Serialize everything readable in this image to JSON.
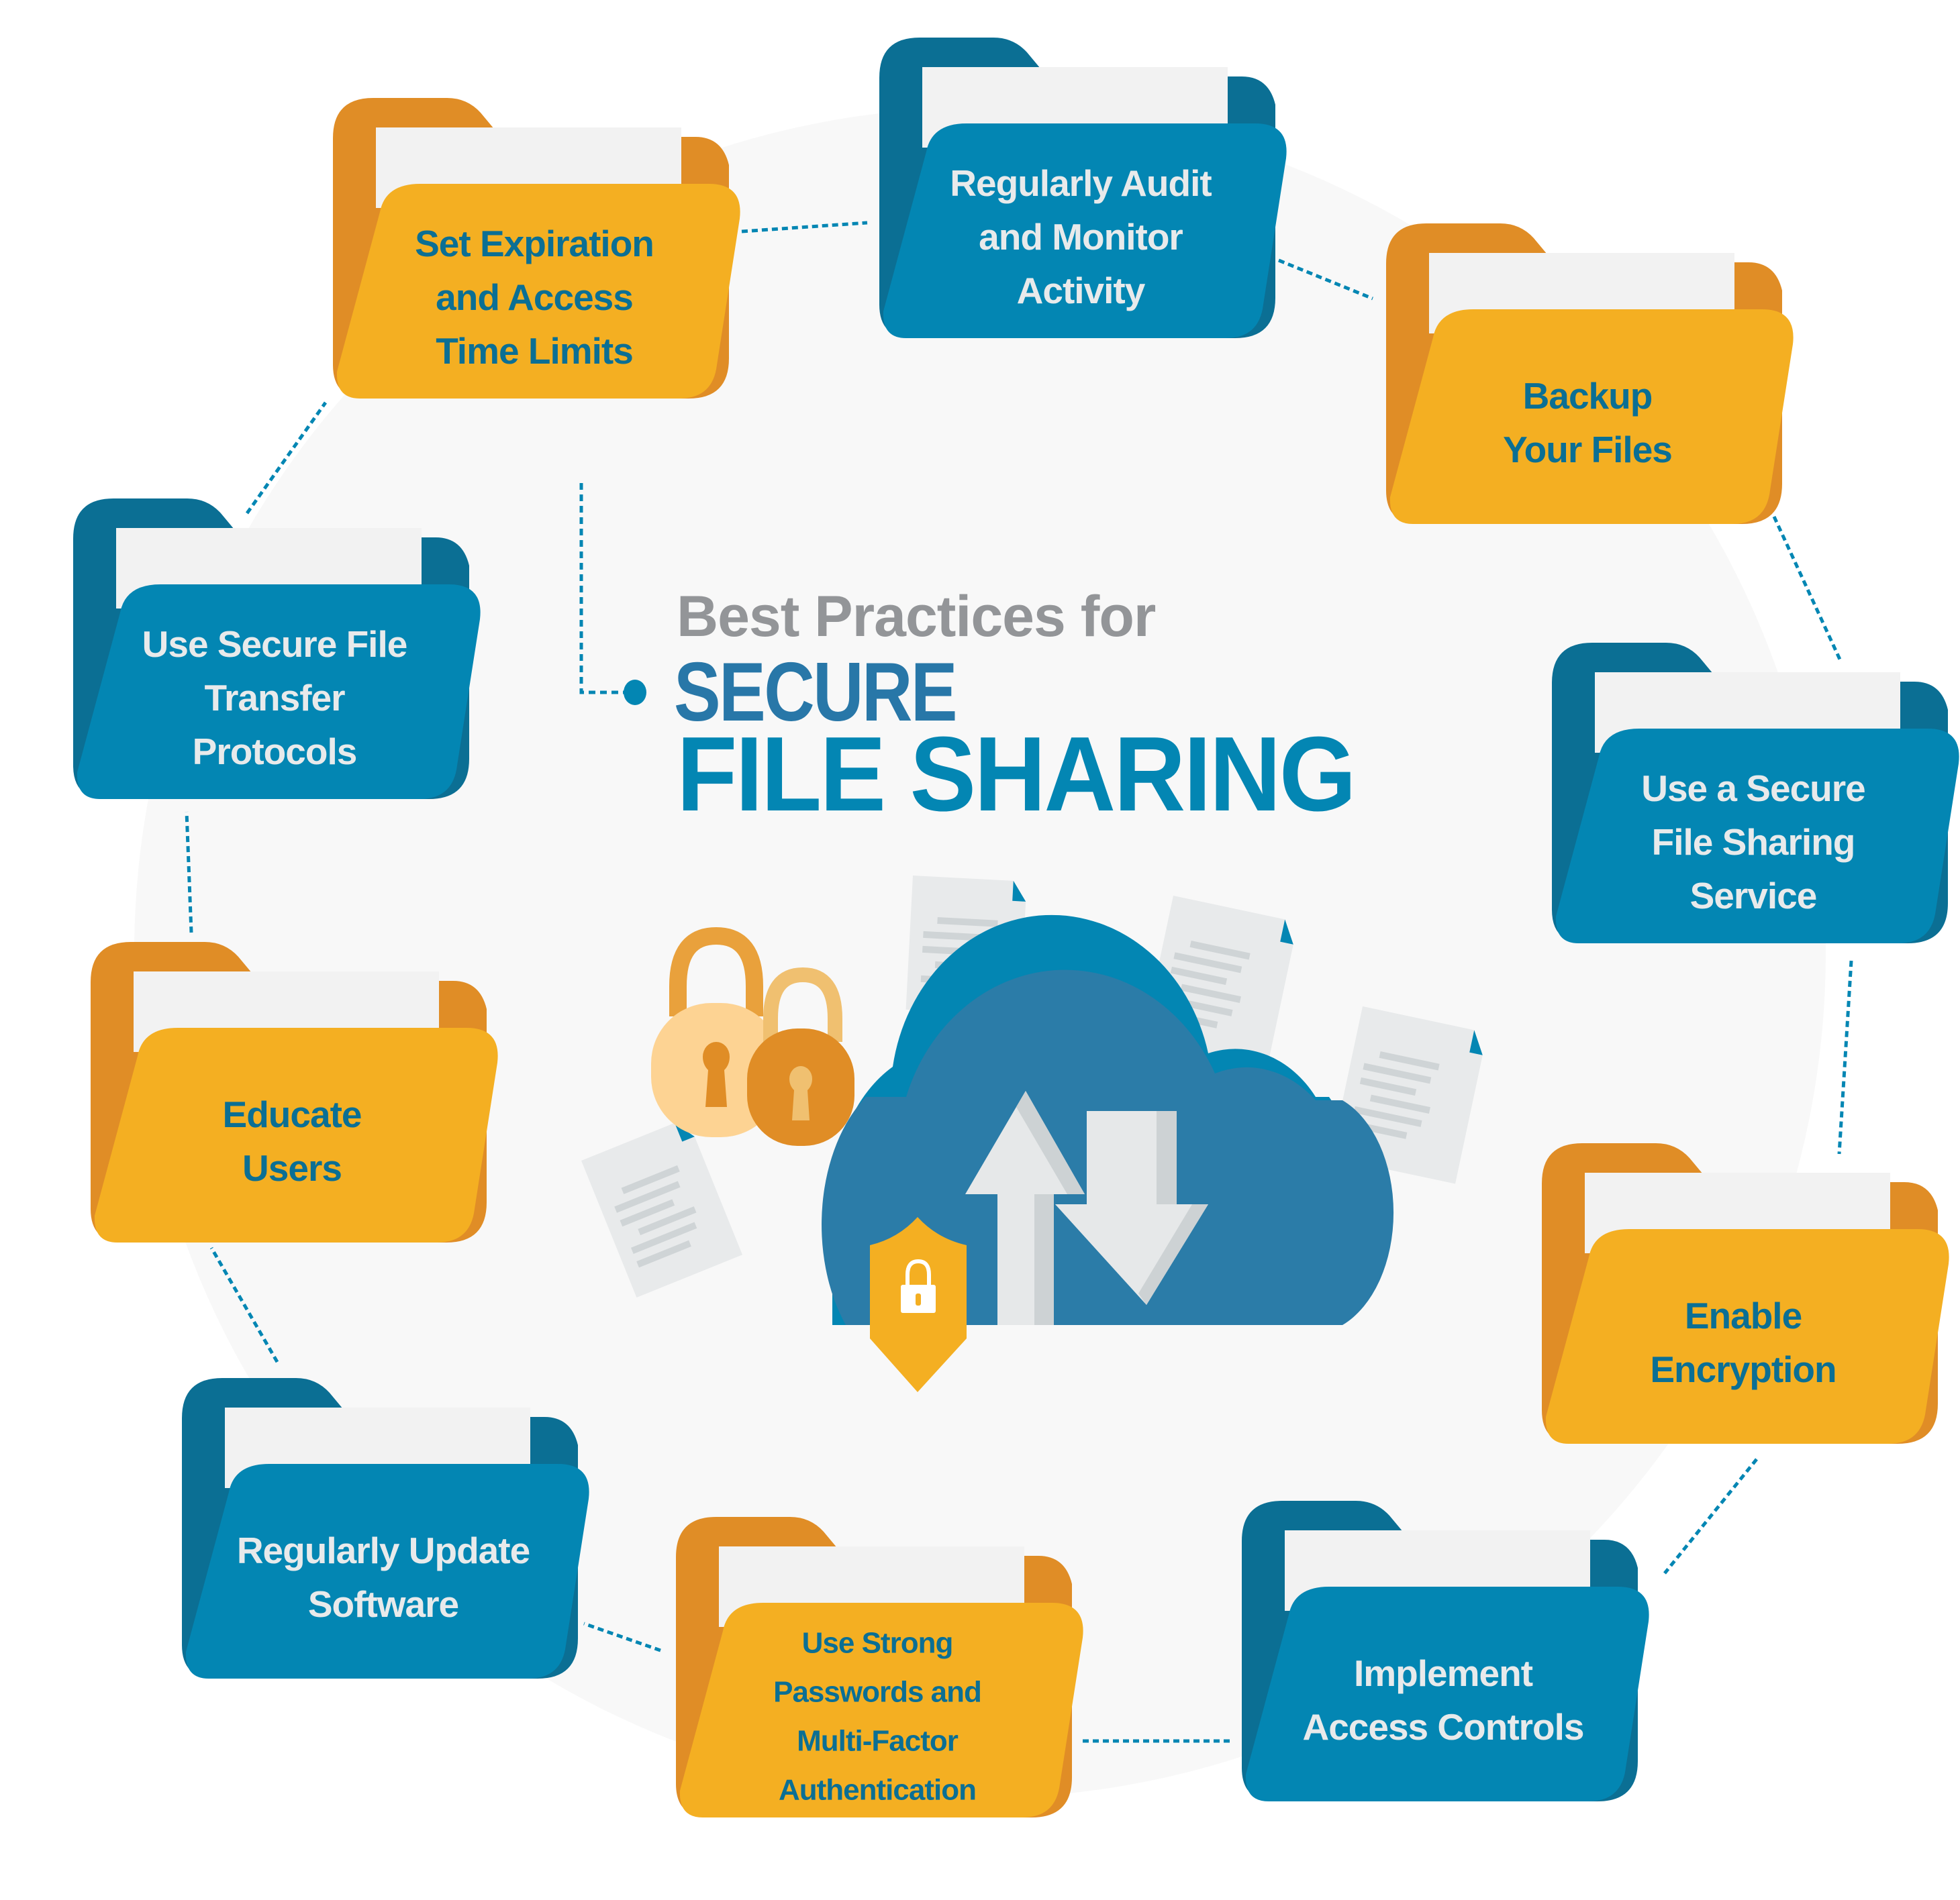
{
  "title": {
    "kicker": "Best Practices for",
    "line1": "SECURE",
    "line2": "FILE SHARING"
  },
  "colors": {
    "blue_front": "#0386b3",
    "blue_back": "#0b6f94",
    "yellow_front": "#f4af22",
    "yellow_back": "#e08d26",
    "paper": "#f2f2f2",
    "text_on_yellow": "#0b6f94",
    "text_on_blue": "#e8eaeb",
    "kicker_gray": "#939598",
    "secure_blue": "#2877a8",
    "file_sharing_blue": "#0386b3",
    "connector": "#0386b3",
    "background_circle": "#f8f8f8",
    "cloud": "#2b7ca8",
    "cloud_shadow": "#0386b3",
    "arrow": "#e6e8e9",
    "arrow_shade": "#cdd2d4",
    "shield": "#f4af22",
    "doc": "#e8eaeb",
    "doc_line": "#cfd4d6",
    "doc_corner": "#0386b3",
    "lock_light": "#fdd393",
    "lock_dark": "#e08d26",
    "lock_shackle": "#e9a13c"
  },
  "practices": [
    {
      "id": "set-expiration",
      "theme": "yellow",
      "lines": [
        "Set Expiration",
        "and Access",
        "Time Limits"
      ]
    },
    {
      "id": "audit-monitor",
      "theme": "blue",
      "lines": [
        "Regularly Audit",
        "and Monitor",
        "Activity"
      ]
    },
    {
      "id": "backup-files",
      "theme": "yellow",
      "lines": [
        "Backup",
        "Your Files"
      ]
    },
    {
      "id": "secure-sharing-service",
      "theme": "blue",
      "lines": [
        "Use a Secure",
        "File Sharing",
        "Service"
      ]
    },
    {
      "id": "enable-encryption",
      "theme": "yellow",
      "lines": [
        "Enable",
        "Encryption"
      ]
    },
    {
      "id": "access-controls",
      "theme": "blue",
      "lines": [
        "Implement",
        "Access Controls"
      ]
    },
    {
      "id": "strong-passwords-mfa",
      "theme": "yellow",
      "lines": [
        "Use Strong",
        "Passwords and",
        "Multi-Factor",
        "Authentication"
      ]
    },
    {
      "id": "update-software",
      "theme": "blue",
      "lines": [
        "Regularly Update",
        "Software"
      ]
    },
    {
      "id": "educate-users",
      "theme": "yellow",
      "lines": [
        "Educate",
        "Users"
      ]
    },
    {
      "id": "secure-transfer-protocols",
      "theme": "blue",
      "lines": [
        "Use Secure File",
        "Transfer",
        "Protocols"
      ]
    }
  ],
  "illustration": {
    "icons": [
      "cloud-icon",
      "upload-arrow-icon",
      "download-arrow-icon",
      "shield-lock-icon",
      "padlock-icon",
      "document-icon"
    ]
  }
}
